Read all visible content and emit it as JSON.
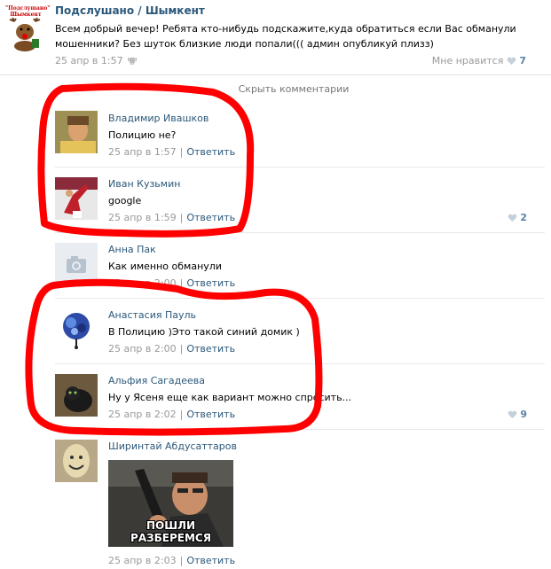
{
  "post": {
    "group_name": "Подслушано / Шымкент",
    "group_logo_text_1": "\"Подслушано\"",
    "group_logo_text_2": "Шымкент",
    "text": "Всем добрый вечер! Ребята кто-нибудь подскажите,куда обратиться если Вас обманули мошенники? Без шуток близкие люди попали((( админ опубликуй плизз)",
    "date": "25 апр в 1:57",
    "like_label": "Мне нравится",
    "likes": "7",
    "device_icon": "android-icon"
  },
  "hide_comments_label": "Скрыть комментарии",
  "reply_label": "Ответить",
  "comments": [
    {
      "name": "Владимир Ивашков",
      "text": "Полицию не?",
      "date": "25 апр в 1:57",
      "likes": ""
    },
    {
      "name": "Иван Кузьмин",
      "text": "google",
      "date": "25 апр в 1:59",
      "likes": "2"
    },
    {
      "name": "Анна Пак",
      "text": "Как именно обманули",
      "date": "25 апр в 2:00",
      "likes": ""
    },
    {
      "name": "Анастасия Пауль",
      "text": "В Полицию )Это такой синий домик )",
      "date": "25 апр в 2:00",
      "likes": ""
    },
    {
      "name": "Альфия Сагадеева",
      "text": "Ну у Ясеня еще как вариант можно спросить...",
      "date": "25 апр в 2:02",
      "likes": "9"
    },
    {
      "name": "Ширинтай Абдусаттаров",
      "text": "",
      "date": "25 апр в 2:03",
      "likes": ""
    }
  ],
  "meme_caption": "ПОШЛИ РАЗБЕРЕМСЯ",
  "colors": {
    "link": "#2b587a",
    "meta": "#999999",
    "highlight": "#ff0000"
  }
}
